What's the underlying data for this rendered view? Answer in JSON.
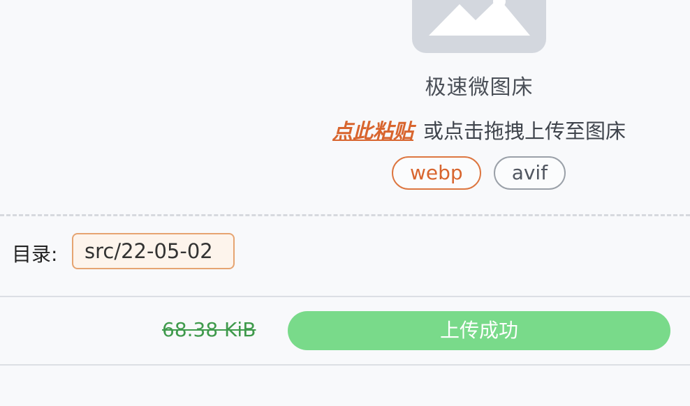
{
  "uploader": {
    "placeholder_icon": "image-icon",
    "title": "极速微图床",
    "paste_link": "点此粘贴",
    "hint": "或点击拖拽上传至图床",
    "formats": [
      {
        "label": "webp",
        "selected": true
      },
      {
        "label": "avif",
        "selected": false
      }
    ]
  },
  "directory": {
    "label": "目录:",
    "value": "src/22-05-02"
  },
  "upload_item": {
    "file_size": "68.38 KiB",
    "status": "上传成功"
  },
  "colors": {
    "accent": "#d8652e",
    "success": "#79da8a",
    "size_text": "#3f9a4c"
  }
}
